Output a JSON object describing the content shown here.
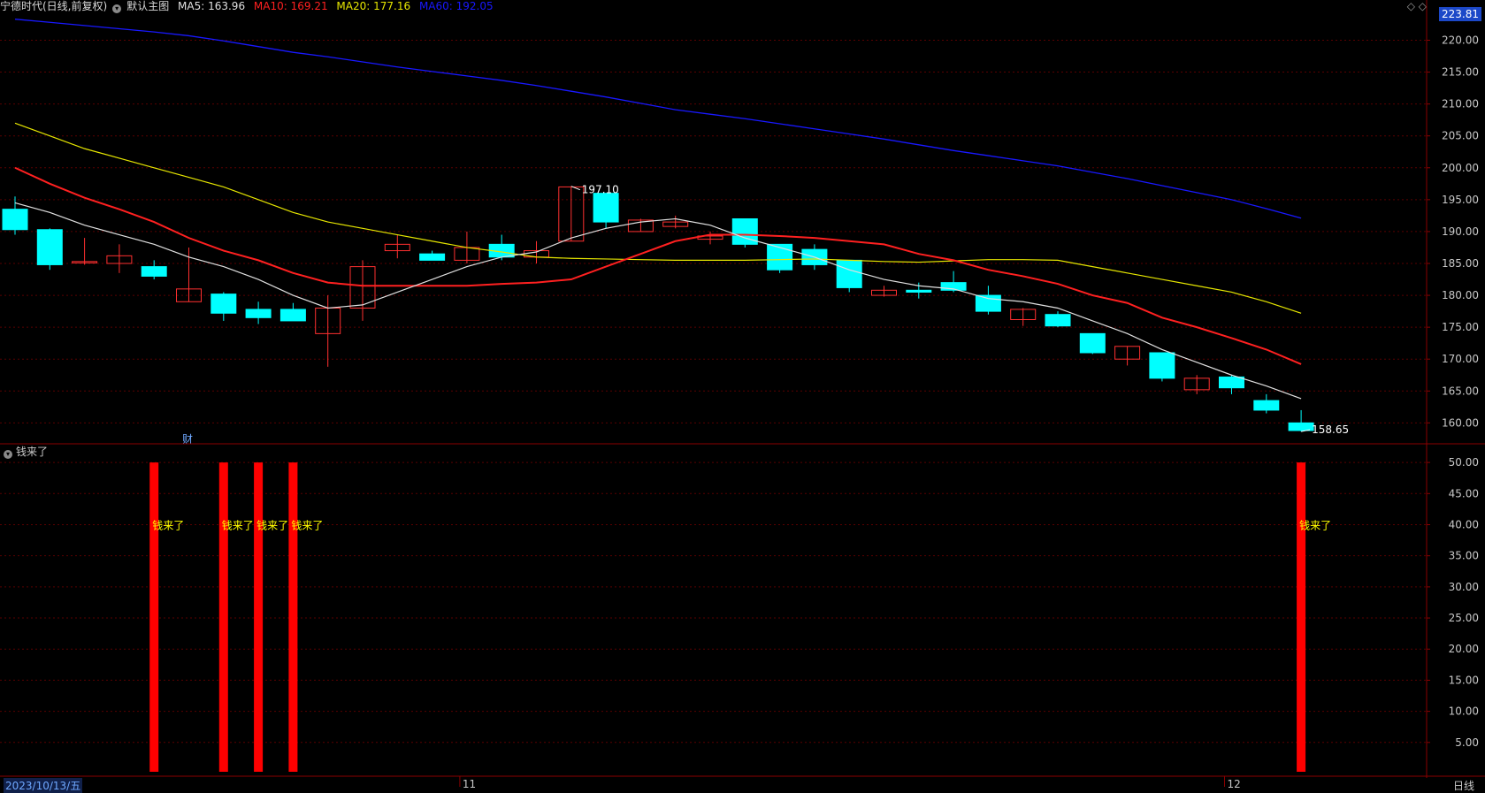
{
  "header": {
    "stock_name": "宁德时代(日线,前复权)",
    "main_chart_label": "默认主图",
    "ma5": "MA5: 163.96",
    "ma10": "MA10: 169.21",
    "ma20": "MA20: 177.16",
    "ma60": "MA60: 192.05"
  },
  "top_right_icon": "◇ ◇",
  "price_axis_top": "223.81",
  "indicator_title": "钱来了",
  "finance_marker": "财",
  "date_label": "2023/10/13/五",
  "period_label": "日线",
  "colors": {
    "ma5": "#e0e0e0",
    "ma10": "#ff2020",
    "ma20": "#e6e600",
    "ma60": "#1818ff",
    "up": "#ff3030",
    "down": "#00ffff",
    "grid": "#5a0000",
    "axis": "#8a0000",
    "signal": "#ff0000",
    "signal_text": "#ffff00"
  },
  "chart_data": {
    "type": "candlestick",
    "price_ylim": [
      157,
      223.81
    ],
    "price_ticks": [
      "220.00",
      "215.00",
      "210.00",
      "205.00",
      "200.00",
      "195.00",
      "190.00",
      "185.00",
      "180.00",
      "175.00",
      "170.00",
      "165.00",
      "160.00"
    ],
    "candles": [
      {
        "o": 193.5,
        "h": 195.5,
        "l": 189.5,
        "c": 190.3
      },
      {
        "o": 190.3,
        "h": 190.5,
        "l": 184.0,
        "c": 184.8
      },
      {
        "o": 185.2,
        "h": 189.0,
        "l": 184.8,
        "c": 185.3
      },
      {
        "o": 185.0,
        "h": 188.0,
        "l": 183.5,
        "c": 186.2
      },
      {
        "o": 184.5,
        "h": 185.5,
        "l": 182.5,
        "c": 183.0
      },
      {
        "o": 179.0,
        "h": 187.5,
        "l": 179.0,
        "c": 181.0
      },
      {
        "o": 180.2,
        "h": 180.5,
        "l": 176.0,
        "c": 177.2
      },
      {
        "o": 177.8,
        "h": 179.0,
        "l": 175.5,
        "c": 176.5
      },
      {
        "o": 177.8,
        "h": 178.8,
        "l": 176.0,
        "c": 176.0
      },
      {
        "o": 174.0,
        "h": 180.0,
        "l": 168.8,
        "c": 178.0
      },
      {
        "o": 178.0,
        "h": 185.5,
        "l": 176.0,
        "c": 184.5
      },
      {
        "o": 187.0,
        "h": 189.5,
        "l": 185.8,
        "c": 188.0
      },
      {
        "o": 186.5,
        "h": 187.0,
        "l": 185.5,
        "c": 185.5
      },
      {
        "o": 185.5,
        "h": 190.0,
        "l": 185.0,
        "c": 187.5
      },
      {
        "o": 188.0,
        "h": 189.5,
        "l": 185.5,
        "c": 186.0
      },
      {
        "o": 186.0,
        "h": 188.5,
        "l": 185.0,
        "c": 187.0
      },
      {
        "o": 188.5,
        "h": 197.1,
        "l": 188.5,
        "c": 197.0
      },
      {
        "o": 196.0,
        "h": 196.0,
        "l": 190.5,
        "c": 191.5
      },
      {
        "o": 190.0,
        "h": 192.0,
        "l": 190.0,
        "c": 191.8
      },
      {
        "o": 190.8,
        "h": 192.5,
        "l": 190.5,
        "c": 191.5
      },
      {
        "o": 188.8,
        "h": 190.0,
        "l": 188.0,
        "c": 189.3
      },
      {
        "o": 192.0,
        "h": 192.0,
        "l": 187.5,
        "c": 188.0
      },
      {
        "o": 188.0,
        "h": 188.0,
        "l": 183.5,
        "c": 184.0
      },
      {
        "o": 187.2,
        "h": 188.0,
        "l": 184.0,
        "c": 184.8
      },
      {
        "o": 185.5,
        "h": 185.5,
        "l": 180.5,
        "c": 181.2
      },
      {
        "o": 180.0,
        "h": 181.5,
        "l": 179.8,
        "c": 180.8
      },
      {
        "o": 180.8,
        "h": 182.0,
        "l": 179.5,
        "c": 180.5
      },
      {
        "o": 182.0,
        "h": 183.8,
        "l": 180.5,
        "c": 180.8
      },
      {
        "o": 180.0,
        "h": 181.5,
        "l": 177.0,
        "c": 177.5
      },
      {
        "o": 176.2,
        "h": 178.0,
        "l": 175.2,
        "c": 177.8
      },
      {
        "o": 177.0,
        "h": 177.5,
        "l": 175.0,
        "c": 175.2
      },
      {
        "o": 174.0,
        "h": 174.0,
        "l": 170.8,
        "c": 171.0
      },
      {
        "o": 170.0,
        "h": 172.0,
        "l": 169.0,
        "c": 172.0
      },
      {
        "o": 171.0,
        "h": 171.0,
        "l": 166.5,
        "c": 167.0
      },
      {
        "o": 165.2,
        "h": 167.5,
        "l": 164.5,
        "c": 167.0
      },
      {
        "o": 167.2,
        "h": 167.5,
        "l": 164.5,
        "c": 165.5
      },
      {
        "o": 163.5,
        "h": 164.5,
        "l": 161.5,
        "c": 162.0
      },
      {
        "o": 160.0,
        "h": 162.0,
        "l": 158.65,
        "c": 158.8
      }
    ],
    "ma5": [
      194.5,
      193.0,
      191.0,
      189.5,
      188.0,
      186.0,
      184.5,
      182.5,
      180.0,
      178.0,
      178.5,
      180.5,
      182.5,
      184.5,
      186.0,
      186.8,
      189.0,
      190.5,
      191.5,
      192.0,
      191.0,
      189.0,
      187.5,
      186.0,
      184.0,
      182.5,
      181.5,
      181.0,
      179.5,
      179.0,
      178.0,
      176.0,
      174.0,
      171.5,
      169.5,
      167.5,
      165.8,
      163.8
    ],
    "ma10": [
      200.0,
      197.5,
      195.3,
      193.5,
      191.5,
      189.0,
      187.0,
      185.5,
      183.5,
      182.0,
      181.5,
      181.5,
      181.5,
      181.5,
      181.8,
      182.0,
      182.5,
      184.5,
      186.5,
      188.5,
      189.5,
      189.5,
      189.3,
      189.0,
      188.5,
      188.0,
      186.5,
      185.5,
      184.0,
      183.0,
      181.8,
      180.0,
      178.8,
      176.5,
      175.0,
      173.3,
      171.5,
      169.2
    ],
    "ma20": [
      207.0,
      205.0,
      203.0,
      201.5,
      200.0,
      198.5,
      197.0,
      195.0,
      193.0,
      191.5,
      190.5,
      189.5,
      188.5,
      187.5,
      186.8,
      186.0,
      185.8,
      185.7,
      185.6,
      185.5,
      185.5,
      185.5,
      185.6,
      185.7,
      185.5,
      185.3,
      185.2,
      185.4,
      185.6,
      185.6,
      185.5,
      184.5,
      183.5,
      182.5,
      181.5,
      180.5,
      179.0,
      177.2
    ],
    "ma60": [
      223.3,
      222.8,
      222.3,
      221.8,
      221.3,
      220.7,
      219.9,
      219.0,
      218.1,
      217.4,
      216.6,
      215.8,
      215.1,
      214.4,
      213.7,
      212.9,
      212.0,
      211.1,
      210.1,
      209.1,
      208.4,
      207.7,
      206.9,
      206.1,
      205.3,
      204.5,
      203.6,
      202.7,
      201.9,
      201.1,
      200.3,
      199.3,
      198.3,
      197.2,
      196.1,
      195.0,
      193.6,
      192.1
    ],
    "high_label": "197.10",
    "low_label": "158.65",
    "x_labels": [
      {
        "index": 13,
        "text": "11"
      },
      {
        "index": 35,
        "text": "12"
      }
    ],
    "indicator": {
      "name": "钱来了",
      "ylim": [
        0,
        53
      ],
      "ticks": [
        "50.00",
        "45.00",
        "40.00",
        "35.00",
        "30.00",
        "25.00",
        "20.00",
        "15.00",
        "10.00",
        "5.00"
      ],
      "signal_value": 50,
      "signal_indices": [
        4,
        6,
        7,
        8,
        37
      ],
      "signal_text": "钱来了"
    }
  }
}
